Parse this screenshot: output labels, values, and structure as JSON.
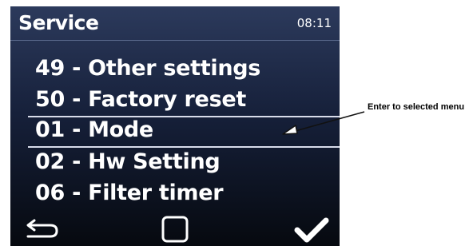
{
  "header": {
    "title": "Service",
    "time": "08:11"
  },
  "menu": {
    "items": [
      {
        "label": "49 - Other settings"
      },
      {
        "label": "50 - Factory reset"
      },
      {
        "label": "01 - Mode",
        "selected": true
      },
      {
        "label": "02 - Hw Setting"
      },
      {
        "label": "06 - Filter timer"
      }
    ]
  },
  "softkeys": [
    {
      "icon": "back-arrow-icon"
    },
    {
      "icon": "square-icon"
    },
    {
      "icon": "checkmark-icon"
    }
  ],
  "annotation": {
    "text": "Enter to selected menu"
  },
  "colors": {
    "screen_top": "#2c3a5c",
    "screen_bottom": "#06090f",
    "text": "#ffffff",
    "selection_line": "#d8dcea"
  }
}
